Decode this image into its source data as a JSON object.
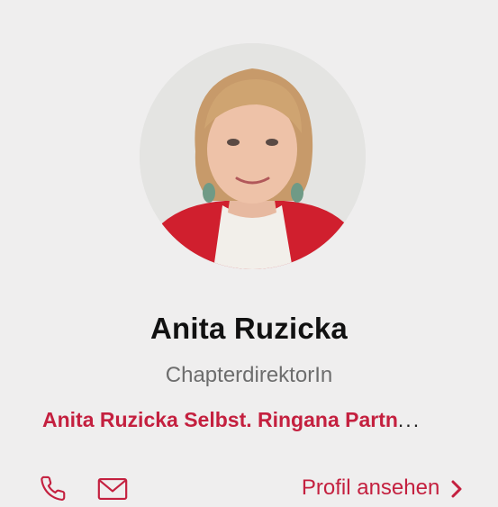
{
  "profile": {
    "name": "Anita Ruzicka",
    "role": "ChapterdirektorIn",
    "company": "Anita Ruzicka Selbst. Ringana Partn",
    "company_ellipsis": "...",
    "view_profile_label": "Profil ansehen"
  },
  "icons": {
    "phone": "phone-icon",
    "email": "mail-icon",
    "chevron": "chevron-right-icon"
  },
  "colors": {
    "accent": "#c4203f",
    "background": "#efeeee",
    "name_text": "#111111",
    "role_text": "#6d6d6d"
  }
}
